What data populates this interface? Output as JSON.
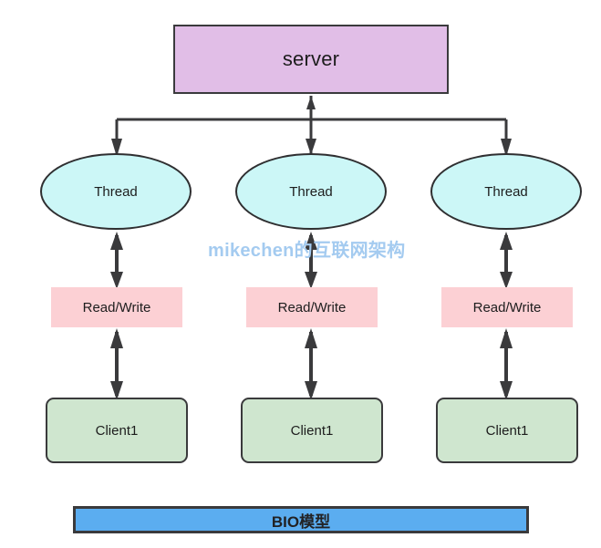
{
  "diagram": {
    "title": "BIO模型",
    "watermark": "mikechen的互联网架构",
    "background_color": "#ffffff",
    "server": {
      "label": "server",
      "fill": "#e1bee7",
      "stroke": "#3a3a3c"
    },
    "threads": [
      {
        "label": "Thread",
        "fill": "#ccf7f7",
        "stroke": "#2f2f31"
      },
      {
        "label": "Thread",
        "fill": "#ccf7f7",
        "stroke": "#2f2f31"
      },
      {
        "label": "Thread",
        "fill": "#ccf7f7",
        "stroke": "#2f2f31"
      }
    ],
    "read_write": [
      {
        "label": "Read/Write",
        "fill": "#fcd0d4"
      },
      {
        "label": "Read/Write",
        "fill": "#fcd0d4"
      },
      {
        "label": "Read/Write",
        "fill": "#fcd0d4"
      }
    ],
    "clients": [
      {
        "label": "Client1",
        "fill": "#cfe6cf",
        "stroke": "#3a3a3c"
      },
      {
        "label": "Client1",
        "fill": "#cfe6cf",
        "stroke": "#3a3a3c"
      },
      {
        "label": "Client1",
        "fill": "#cfe6cf",
        "stroke": "#3a3a3c"
      }
    ],
    "banner": {
      "label": "BIO模型",
      "fill": "#5badf0",
      "stroke": "#3a3a3c"
    },
    "connectors": {
      "stroke": "#3a3a3c",
      "server_to_threads": "one-to-many branch with arrowheads into each thread, plus upward arrow into server",
      "thread_to_read_write": "bidirectional double arrow",
      "read_write_to_client": "bidirectional double arrow"
    }
  }
}
